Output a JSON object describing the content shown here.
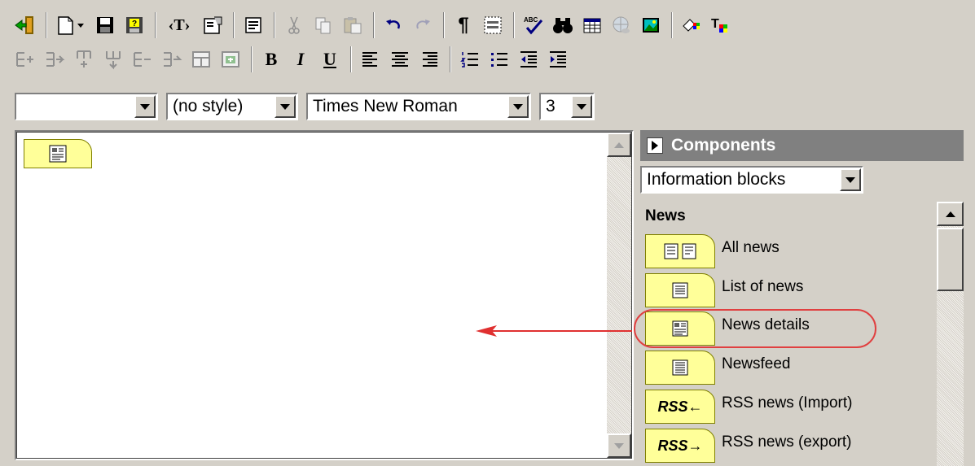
{
  "format": {
    "block_value": "",
    "style_value": "(no style)",
    "font_value": "Times New Roman",
    "size_value": "3"
  },
  "toolbar": {
    "text_tag_label": "‹T›",
    "bold_label": "B",
    "italic_label": "I",
    "underline_label": "U"
  },
  "components": {
    "title": "Components",
    "category_value": "Information blocks",
    "group_label": "News",
    "items": [
      {
        "label": "All news",
        "icon": "all-news-icon"
      },
      {
        "label": "List of news",
        "icon": "news-list-icon"
      },
      {
        "label": "News details",
        "icon": "news-detail-icon"
      },
      {
        "label": "Newsfeed",
        "icon": "newsfeed-icon"
      },
      {
        "label": "RSS news (Import)",
        "icon": "rss-import-icon",
        "badge": "RSS←"
      },
      {
        "label": "RSS news (export)",
        "icon": "rss-export-icon",
        "badge": "RSS→"
      }
    ]
  },
  "colors": {
    "block_fill": "#ffff99",
    "highlight": "#e04040",
    "panel_header": "#808080"
  }
}
